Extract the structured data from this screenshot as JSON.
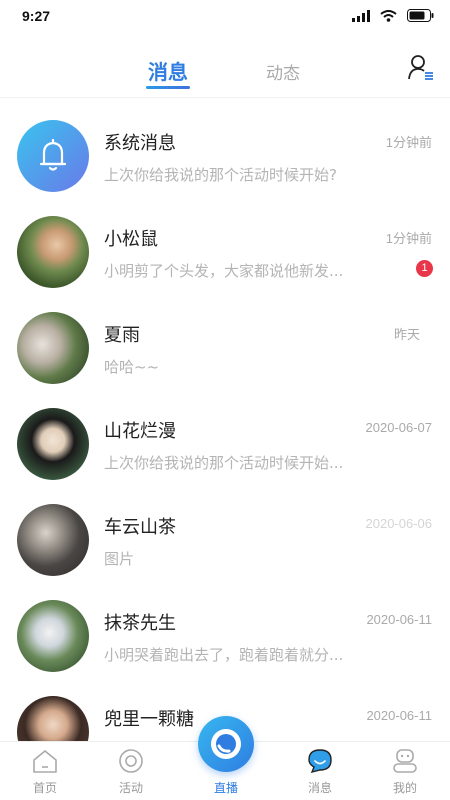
{
  "status": {
    "time": "9:27"
  },
  "tabs": {
    "messages": "消息",
    "feed": "动态"
  },
  "messages": [
    {
      "name": "系统消息",
      "preview": "上次你给我说的那个活动时候开始?",
      "time": "1分钟前",
      "avatar": "bell-icon"
    },
    {
      "name": "小松鼠",
      "preview": "小明剪了个头发，大家都说他新发...",
      "time": "1分钟前",
      "badge": "1"
    },
    {
      "name": "夏雨",
      "preview": "哈哈~~",
      "time": "昨天"
    },
    {
      "name": "山花烂漫",
      "preview": "上次你给我说的那个活动时候开始...",
      "time": "2020-06-07"
    },
    {
      "name": "车云山茶",
      "preview": "图片",
      "time": "2020-06-06"
    },
    {
      "name": "抹茶先生",
      "preview": "小明哭着跑出去了，跑着跑着就分...",
      "time": "2020-06-11"
    },
    {
      "name": "兜里一颗糖",
      "preview": "",
      "time": "2020-06-11"
    }
  ],
  "bottom_nav": {
    "home": "首页",
    "activity": "活动",
    "live": "直播",
    "messages": "消息",
    "mine": "我的"
  },
  "colors": {
    "accent": "#2f7de1",
    "badge": "#e8364a"
  }
}
